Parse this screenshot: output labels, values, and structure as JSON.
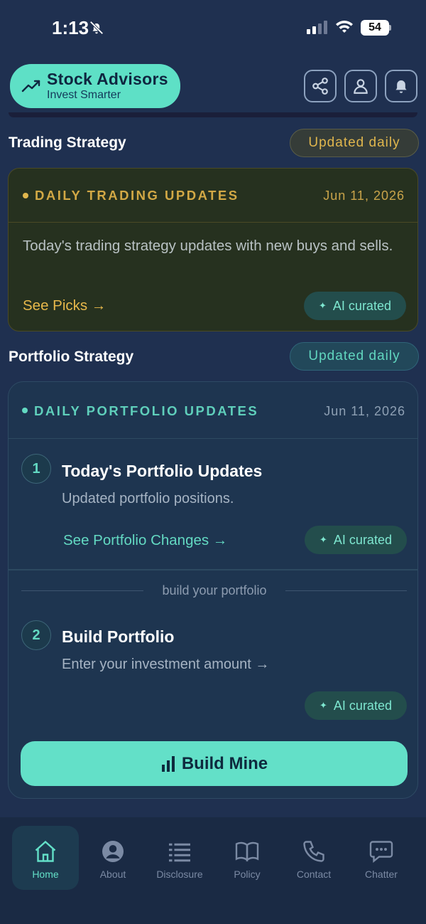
{
  "status": {
    "time": "1:13",
    "battery": "54"
  },
  "header": {
    "title": "Stock Advisors",
    "subtitle": "Invest Smarter",
    "icons": [
      "share-icon",
      "user-icon",
      "bell-icon"
    ]
  },
  "trading": {
    "section_title": "Trading Strategy",
    "badge": "Updated daily",
    "kicker": "DAILY TRADING UPDATES",
    "date": "Jun 11, 2026",
    "description": "Today's trading strategy updates with new buys and sells.",
    "link": "See Picks →",
    "ai_label": "AI curated"
  },
  "portfolio": {
    "section_title": "Portfolio Strategy",
    "badge": "Updated daily",
    "kicker": "DAILY PORTFOLIO UPDATES",
    "date": "Jun 11, 2026",
    "items": [
      {
        "number": "1",
        "title": "Today's Portfolio Updates",
        "subtitle": "Updated portfolio positions.",
        "link": "See Portfolio Changes →",
        "ai_label": "AI curated"
      },
      {
        "number": "2",
        "title": "Build Portfolio",
        "subtitle": "Enter your investment amount →",
        "ai_label": "AI curated"
      }
    ],
    "divider_label": "build your portfolio",
    "build_button": "Build Mine"
  },
  "nav": [
    {
      "label": "Home",
      "icon": "home-icon",
      "active": true
    },
    {
      "label": "About",
      "icon": "user-circle-icon"
    },
    {
      "label": "Disclosure",
      "icon": "list-icon"
    },
    {
      "label": "Policy",
      "icon": "book-icon"
    },
    {
      "label": "Contact",
      "icon": "phone-icon"
    },
    {
      "label": "Chatter",
      "icon": "chat-icon"
    }
  ],
  "colors": {
    "accent": "#63e0c8",
    "gold": "#e0b64d",
    "background": "#1f3050"
  }
}
